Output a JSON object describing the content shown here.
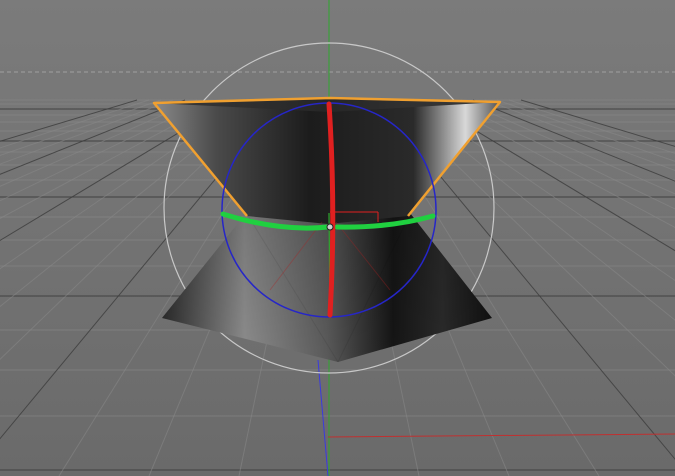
{
  "viewport": {
    "view": "perspective",
    "colors": {
      "background_top": "#7a7a7a",
      "background_bottom": "#6c6c6c",
      "grid_line": "#888888",
      "grid_major": "#3c3c3c",
      "horizon_dashed": "#9a9a9a",
      "world_axis_y": "#2ea82e",
      "world_axis_z": "#3a3ae0",
      "world_axis_x": "#c03030",
      "selection_outline": "#f0a030",
      "rotate_ring_outer": "#c8c8c8",
      "rotate_ring_screen": "#2626c8",
      "rotate_ring_red": "#e02020",
      "rotate_ring_green": "#20d040",
      "object_light": "#b0b0b0",
      "object_dark": "#141414"
    }
  },
  "object": {
    "name": "",
    "shape": "double-cone (hourglass) primitive",
    "selected": true
  },
  "gizmo": {
    "mode": "rotate",
    "rings": [
      "outer-view-ring",
      "screen-ring",
      "heading-ring",
      "pitch-ring"
    ]
  }
}
